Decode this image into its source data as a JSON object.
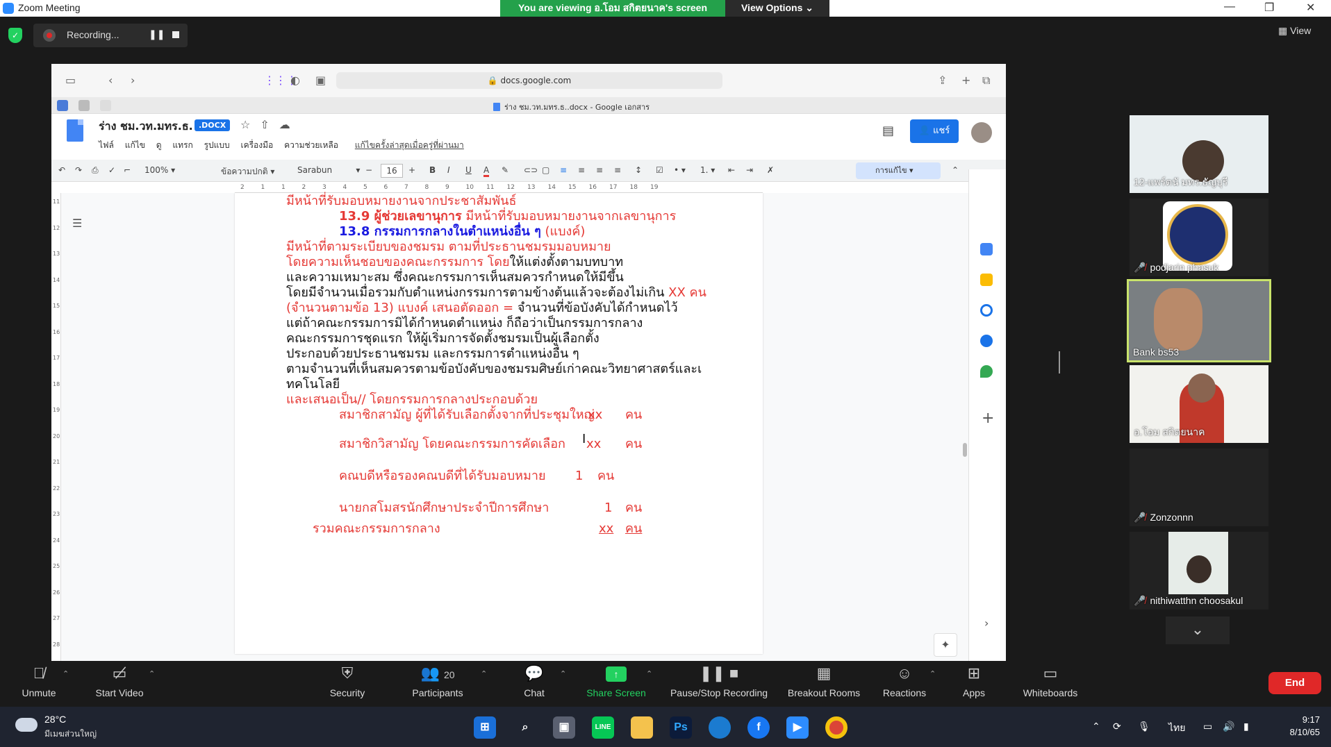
{
  "zoom": {
    "window_title": "Zoom Meeting",
    "viewing_banner": "You are viewing อ.โอม สกิตยนาค's screen",
    "view_options": "View Options ⌄",
    "recording_label": "Recording...",
    "view_label": "View"
  },
  "browser": {
    "url": "docs.google.com",
    "tab_title": "ร่าง ชม.วท.มทร.ธ..docx - Google เอกสาร"
  },
  "docs": {
    "doc_title": "ร่าง ชม.วท.มทร.ธ.",
    "badge": ".DOCX",
    "menus": [
      "ไฟล์",
      "แก้ไข",
      "ดู",
      "แทรก",
      "รูปแบบ",
      "เครื่องมือ",
      "ความช่วยเหลือ"
    ],
    "last_edit": "แก้ไขครั้งล่าสุดเมื่อครู่ที่ผ่านมา",
    "share_label": "แชร์",
    "toolbar": {
      "zoom": "100%",
      "style": "ข้อความปกติ",
      "font": "Sarabun",
      "font_size": "16",
      "edit_mode": "การแก้ไข"
    },
    "ruler_numbers": [
      "2",
      "1",
      "1",
      "2",
      "3",
      "4",
      "5",
      "6",
      "7",
      "8",
      "9",
      "10",
      "11",
      "12",
      "13",
      "14",
      "15",
      "16",
      "17",
      "18",
      "19"
    ],
    "vruler_numbers": [
      "11",
      "12",
      "13",
      "14",
      "15",
      "16",
      "17",
      "18",
      "19",
      "20",
      "21",
      "22",
      "23",
      "24",
      "25",
      "26",
      "27",
      "28"
    ]
  },
  "document_lines": {
    "l1": "มีหน้าที่รับมอบหมายงานจากประชาสัมพันธ์",
    "l2a": "13.9 ผู้ช่วยเลขานุการ",
    "l2b": " มีหน้าที่รับมอบหมายงานจากเลขานุการ",
    "l3a": "13.8 กรรมการกลางในตำแหน่งอื่น ๆ",
    "l3b": " (แบงค์)",
    "l4": "มีหน้าที่ตามระเบียบของชมรม ตามที่ประธานชมรมมอบหมาย",
    "l5a": "โดยความเห็นชอบของคณะกรรมการ โดย",
    "l5b": "ให้แต่งตั้งตามบทบาท",
    "l6": "และความเหมาะสม ซึ่งคณะกรรมการเห็นสมควรกำหนดให้มีขึ้น",
    "l7a": "โดยมีจำนวนเมื่อรวมกับตำแหน่งกรรมการตามข้างต้นแล้วจะต้องไม่เกิน ",
    "l7b": "XX คน",
    "l8a": "(จำนวนตามข้อ 13)  แบงค์ เสนอตัดออก = ",
    "l8b": "จำนวนที่ข้อบังคับได้กำหนดไว้",
    "l9": "แต่ถ้าคณะกรรมการมิได้กำหนดตำแหน่ง ก็ถือว่าเป็นกรรมการกลาง",
    "l10": "คณะกรรมการชุดแรก ให้ผู้เริ่มการจัดตั้งชมรมเป็นผู้เลือกตั้ง",
    "l11": "ประกอบด้วยประธานชมรม และกรรมการตำแหน่งอื่น ๆ",
    "l12": "ตามจำนวนที่เห็นสมควรตามข้อบังคับของชมรมศิษย์เก่าคณะวิทยาศาสตร์และเ",
    "l13": "ทคโนโลยี",
    "l14": "และเสนอเป็น// โดยกรรมการกลางประกอบด้วย",
    "rows": [
      {
        "label": "สมาชิกสามัญ ผู้ที่ได้รับเลือกตั้งจากที่ประชุมใหญ่",
        "count": "xx",
        "unit": "คน"
      },
      {
        "label": "สมาชิกวิสามัญ โดยคณะกรรมการคัดเลือก",
        "count": "xx",
        "unit": "คน"
      },
      {
        "label": "คณบดีหรือรองคณบดีที่ได้รับมอบหมาย",
        "count": "1",
        "unit": "คน"
      },
      {
        "label": "นายกสโมสรนักศึกษาประจำปีการศึกษา",
        "count": "1",
        "unit": "คน"
      }
    ],
    "total_label": "รวมคณะกรรมการกลาง",
    "total_count": "xx",
    "total_unit": "คน"
  },
  "participants": [
    {
      "name": "12-แพร์ตนั มทร.ธัญบุรี",
      "muted": false
    },
    {
      "name": "podjarin phasuk",
      "muted": true
    },
    {
      "name": "Bank bs53",
      "muted": false
    },
    {
      "name": "อ.โอม สกิตยนาค",
      "muted": false
    },
    {
      "name": "Zonzonnn",
      "muted": true
    },
    {
      "name": "nithiwatthn choosakul",
      "muted": true
    }
  ],
  "controls": {
    "unmute": "Unmute",
    "start_video": "Start Video",
    "security": "Security",
    "participants": "Participants",
    "participants_count": "20",
    "chat": "Chat",
    "share_screen": "Share Screen",
    "pause_recording": "Pause/Stop Recording",
    "breakout": "Breakout Rooms",
    "reactions": "Reactions",
    "apps": "Apps",
    "whiteboards": "Whiteboards",
    "end": "End"
  },
  "taskbar": {
    "temperature": "28°C",
    "location": "มีเมฆส่วนใหญ่",
    "language": "ไทย",
    "time": "9:17",
    "date": "8/10/65"
  }
}
